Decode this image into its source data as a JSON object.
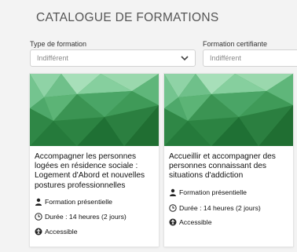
{
  "header": {
    "title": "CATALOGUE DE FORMATIONS"
  },
  "filters": [
    {
      "label": "Type de formation",
      "value": "Indifférent"
    },
    {
      "label": "Formation certifiante",
      "value": "Indifférent"
    }
  ],
  "cards": [
    {
      "title": "Accompagner les personnes logées en résidence sociale : Logement d'Abord et nouvelles postures professionnelles",
      "mode": "Formation présentielle",
      "duration": "Durée : 14 heures (2 jours)",
      "access": "Accessible"
    },
    {
      "title": "Accueillir et accompagner des personnes connaissant des situations d'addiction",
      "mode": "Formation présentielle",
      "duration": "Durée : 14 heures (2 jours)",
      "access": "Accessible"
    }
  ],
  "colors": {
    "background": "#f3f3f3",
    "card": "#ffffff",
    "thumbnail_green": "#3f9a4f"
  },
  "icons": [
    "chevron-down-icon",
    "user-icon",
    "clock-icon",
    "accessibility-icon"
  ]
}
